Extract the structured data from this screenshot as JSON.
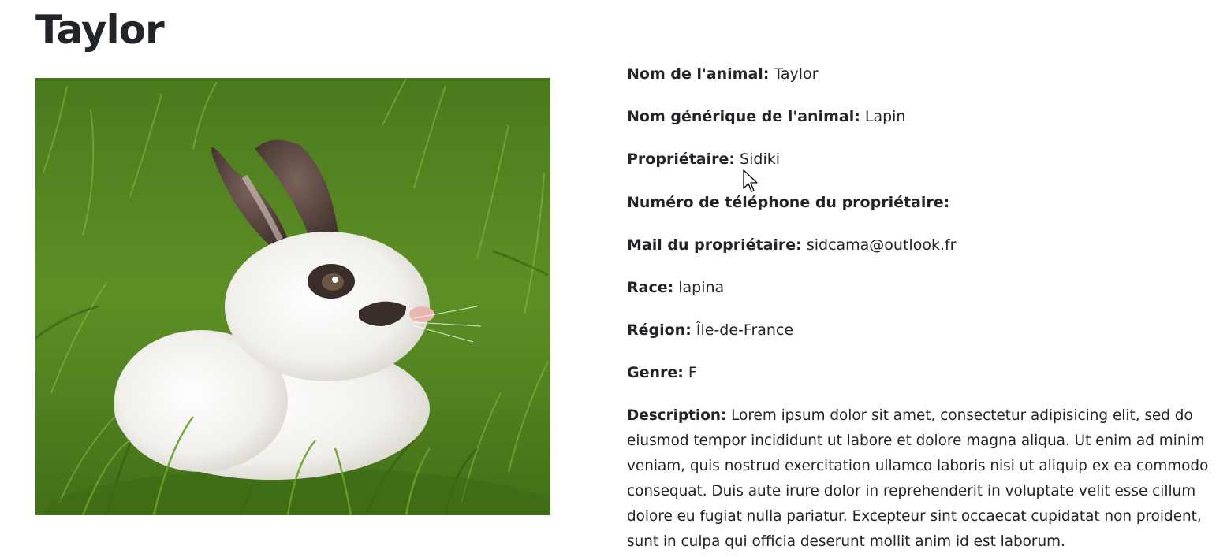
{
  "title": "Taylor",
  "photo": {
    "subject": "white rabbit with dark ears sitting in grass",
    "colors": {
      "grass_dark": "#3f6b18",
      "grass_light": "#7fae35",
      "fur": "#f4f2ee",
      "ears": "#5a4640"
    }
  },
  "details": {
    "name": {
      "label": "Nom de l'animal:",
      "value": "Taylor"
    },
    "generic_name": {
      "label": "Nom générique de l'animal:",
      "value": "Lapin"
    },
    "owner": {
      "label": "Propriétaire:",
      "value": "Sidiki"
    },
    "owner_phone": {
      "label": "Numéro de téléphone du propriétaire:",
      "value": ""
    },
    "owner_mail": {
      "label": "Mail du propriétaire:",
      "value": "sidcama@outlook.fr"
    },
    "breed": {
      "label": "Race:",
      "value": "lapina"
    },
    "region": {
      "label": "Région:",
      "value": "Île-de-France"
    },
    "gender": {
      "label": "Genre:",
      "value": "F"
    },
    "description": {
      "label": "Description:",
      "value": "Lorem ipsum dolor sit amet, consectetur adipisicing elit, sed do eiusmod tempor incididunt ut labore et dolore magna aliqua. Ut enim ad minim veniam, quis nostrud exercitation ullamco laboris nisi ut aliquip ex ea commodo consequat. Duis aute irure dolor in reprehenderit in voluptate velit esse cillum dolore eu fugiat nulla pariatur. Excepteur sint occaecat cupidatat non proident, sunt in culpa qui officia deserunt mollit anim id est laborum."
    }
  }
}
